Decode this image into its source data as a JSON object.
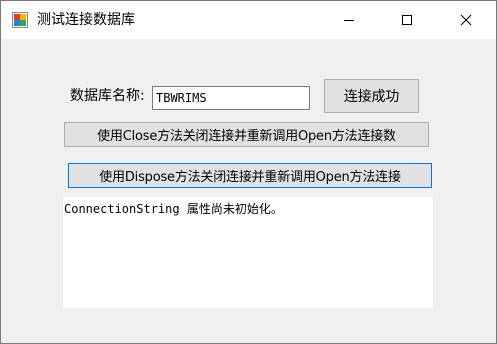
{
  "window": {
    "title": "测试连接数据库",
    "controls": {
      "minimize": "minimize-icon",
      "maximize": "maximize-icon",
      "close": "close-icon"
    }
  },
  "form": {
    "db_name_label": "数据库名称:",
    "db_name_value": "TBWRIMS",
    "status_button_label": "连接成功",
    "close_reopen_button_label": "使用Close方法关闭连接并重新调用Open方法连接数",
    "dispose_reopen_button_label": "使用Dispose方法关闭连接并重新调用Open方法连接",
    "output_text": "ConnectionString 属性尚未初始化。"
  },
  "colors": {
    "window_bg": "#f0f0f0",
    "titlebar_bg": "#ffffff",
    "button_bg": "#e1e1e1",
    "focus_border": "#0078d7"
  }
}
